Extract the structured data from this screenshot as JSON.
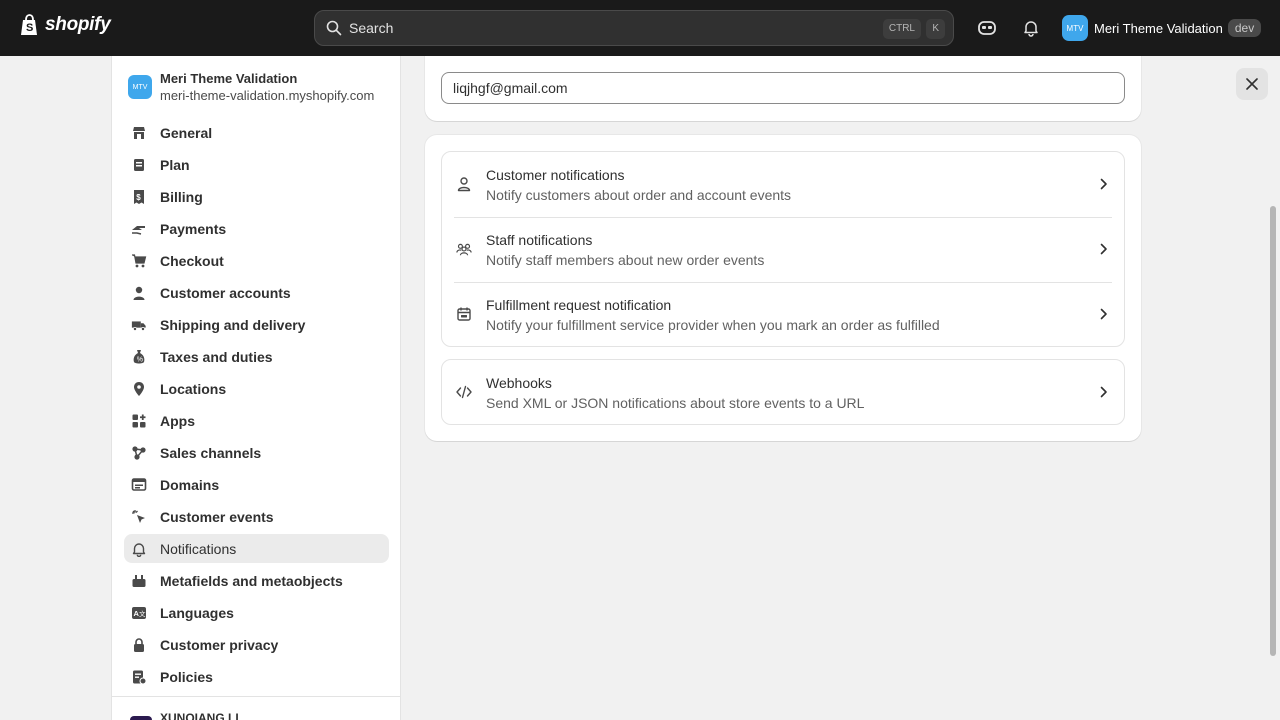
{
  "topbar": {
    "logo_text": "shopify",
    "search_placeholder": "Search",
    "shortcut_ctrl": "CTRL",
    "shortcut_k": "K",
    "store_initials": "MTV",
    "store_name": "Meri Theme Validation",
    "badge": "dev"
  },
  "sidebar": {
    "store_initials": "MTV",
    "store_name": "Meri Theme Validation",
    "store_url": "meri-theme-validation.myshopify.com",
    "items": [
      {
        "label": "General",
        "icon": "store-icon"
      },
      {
        "label": "Plan",
        "icon": "plan-icon"
      },
      {
        "label": "Billing",
        "icon": "billing-icon"
      },
      {
        "label": "Payments",
        "icon": "payments-icon"
      },
      {
        "label": "Checkout",
        "icon": "cart-icon"
      },
      {
        "label": "Customer accounts",
        "icon": "person-icon"
      },
      {
        "label": "Shipping and delivery",
        "icon": "truck-icon"
      },
      {
        "label": "Taxes and duties",
        "icon": "tax-icon"
      },
      {
        "label": "Locations",
        "icon": "location-icon"
      },
      {
        "label": "Apps",
        "icon": "apps-icon"
      },
      {
        "label": "Sales channels",
        "icon": "channels-icon"
      },
      {
        "label": "Domains",
        "icon": "domains-icon"
      },
      {
        "label": "Customer events",
        "icon": "events-icon"
      },
      {
        "label": "Notifications",
        "icon": "bell-icon",
        "active": true
      },
      {
        "label": "Metafields and metaobjects",
        "icon": "metafields-icon"
      },
      {
        "label": "Languages",
        "icon": "languages-icon"
      },
      {
        "label": "Customer privacy",
        "icon": "lock-icon"
      },
      {
        "label": "Policies",
        "icon": "policies-icon"
      }
    ],
    "footer_name": "XUNQIANG LI"
  },
  "main": {
    "sender_email": "liqjhgf@gmail.com",
    "notification_rows": [
      {
        "title": "Customer notifications",
        "description": "Notify customers about order and account events",
        "icon": "person-icon"
      },
      {
        "title": "Staff notifications",
        "description": "Notify staff members about new order events",
        "icon": "people-icon"
      },
      {
        "title": "Fulfillment request notification",
        "description": "Notify your fulfillment service provider when you mark an order as fulfilled",
        "icon": "calendar-box-icon"
      }
    ],
    "webhooks": {
      "title": "Webhooks",
      "description": "Send XML or JSON notifications about store events to a URL",
      "icon": "code-icon"
    }
  }
}
